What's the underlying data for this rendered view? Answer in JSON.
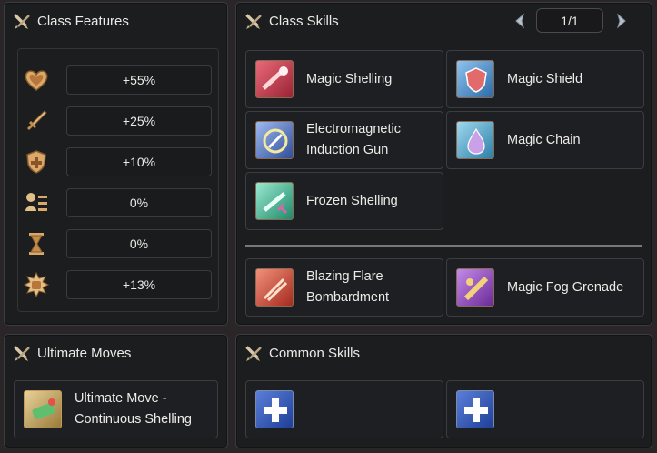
{
  "class_features": {
    "title": "Class Features",
    "stats": [
      {
        "icon": "heart-icon",
        "value": "+55%"
      },
      {
        "icon": "sword-icon",
        "value": "+25%"
      },
      {
        "icon": "shield-cross-icon",
        "value": "+10%"
      },
      {
        "icon": "list-person-icon",
        "value": "0%"
      },
      {
        "icon": "hourglass-icon",
        "value": "0%"
      },
      {
        "icon": "fist-burst-icon",
        "value": "+13%"
      }
    ]
  },
  "class_skills": {
    "title": "Class Skills",
    "page": "1/1",
    "skills": [
      {
        "name": "Magic Shelling",
        "icon": "magic-shelling-icon",
        "color": "#c23a4a"
      },
      {
        "name": "Magic Shield",
        "icon": "magic-shield-icon",
        "color": "#3b7fc4"
      },
      {
        "name": "Electromagnetic Induction Gun",
        "line1": "Electromagnetic",
        "line2": "Induction Gun",
        "icon": "em-gun-icon",
        "color": "#5a7fc0"
      },
      {
        "name": "Magic Chain",
        "icon": "magic-chain-icon",
        "color": "#3aa0c8"
      },
      {
        "name": "Frozen Shelling",
        "icon": "frozen-shelling-icon",
        "color": "#3aa88a"
      }
    ],
    "extra_skills": [
      {
        "name": "Blazing Flare Bombardment",
        "line1": "Blazing Flare",
        "line2": "Bombardment",
        "icon": "blazing-flare-icon",
        "color": "#b8402f"
      },
      {
        "name": "Magic Fog Grenade",
        "icon": "fog-grenade-icon",
        "color": "#8a3aa8"
      }
    ]
  },
  "ultimate_moves": {
    "title": "Ultimate Moves",
    "item": {
      "line1": "Ultimate Move -",
      "line2": "Continuous Shelling",
      "icon": "ultimate-shelling-icon"
    }
  },
  "common_skills": {
    "title": "Common Skills",
    "slots": [
      {
        "icon": "add-skill-icon"
      },
      {
        "icon": "add-skill-icon"
      }
    ]
  }
}
